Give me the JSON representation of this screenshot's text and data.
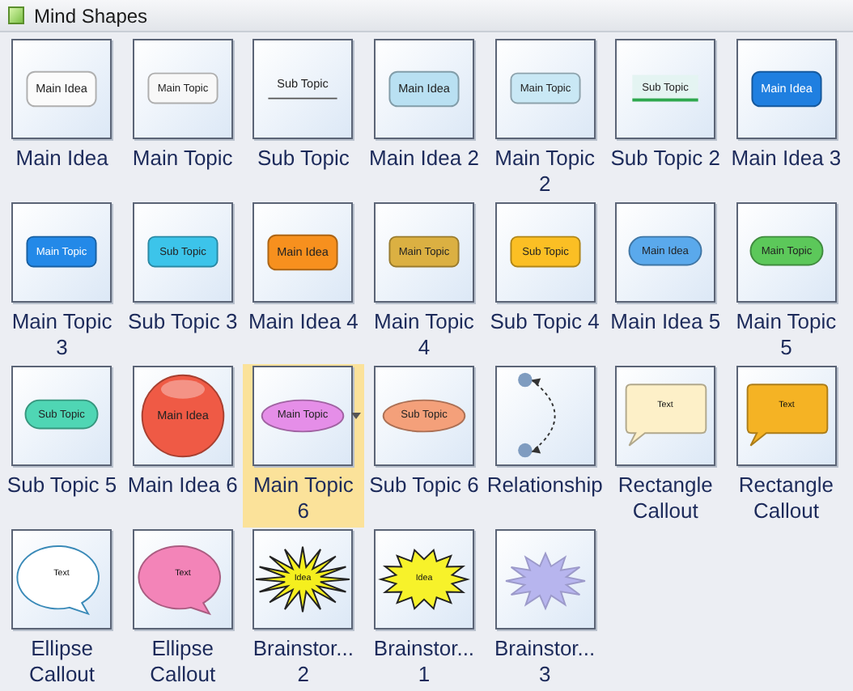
{
  "panel": {
    "title": "Mind Shapes"
  },
  "shapes": [
    {
      "label": "Main Idea",
      "kind": "box",
      "text": "Main Idea",
      "color": "#fbfbfb",
      "selected": false
    },
    {
      "label": "Main Topic",
      "kind": "box-small",
      "text": "Main Topic",
      "color": "#f8f8f8",
      "selected": false
    },
    {
      "label": "Sub Topic",
      "kind": "underline",
      "text": "Sub Topic",
      "color": "#555555",
      "selected": false
    },
    {
      "label": "Main Idea 2",
      "kind": "box",
      "text": "Main Idea",
      "color": "#b9e0f2",
      "selected": false
    },
    {
      "label": "Main Topic 2",
      "kind": "box-small",
      "text": "Main Topic",
      "color": "#c9e8f5",
      "selected": false
    },
    {
      "label": "Sub Topic 2",
      "kind": "tab",
      "text": "Sub Topic",
      "color": "#2fa84f",
      "selected": false
    },
    {
      "label": "Main Idea 3",
      "kind": "box",
      "text": "Main Idea",
      "color": "#1f7fe0",
      "selected": false
    },
    {
      "label": "Main Topic 3",
      "kind": "box-small",
      "text": "Main Topic",
      "color": "#2389e8",
      "selected": false
    },
    {
      "label": "Sub Topic 3",
      "kind": "box-small",
      "text": "Sub Topic",
      "color": "#3cc4ea",
      "selected": false
    },
    {
      "label": "Main Idea 4",
      "kind": "box",
      "text": "Main Idea",
      "color": "#f7901e",
      "selected": false
    },
    {
      "label": "Main Topic 4",
      "kind": "box-small",
      "text": "Main Topic",
      "color": "#dbb042",
      "selected": false
    },
    {
      "label": "Sub Topic 4",
      "kind": "box-small",
      "text": "Sub Topic",
      "color": "#fbbf24",
      "selected": false
    },
    {
      "label": "Main Idea 5",
      "kind": "pill",
      "text": "Main Idea",
      "color": "#5aa9ec",
      "selected": false
    },
    {
      "label": "Main Topic 5",
      "kind": "pill",
      "text": "Main Topic",
      "color": "#5cc85a",
      "selected": false
    },
    {
      "label": "Sub Topic 5",
      "kind": "pill",
      "text": "Sub Topic",
      "color": "#4fd6b4",
      "selected": false
    },
    {
      "label": "Main Idea 6",
      "kind": "circle",
      "text": "Main Idea",
      "color": "#ef5a45",
      "selected": false
    },
    {
      "label": "Main Topic 6",
      "kind": "ellipse",
      "text": "Main Topic",
      "color": "#e58ee8",
      "selected": true
    },
    {
      "label": "Sub Topic 6",
      "kind": "ellipse",
      "text": "Sub Topic",
      "color": "#f4a07a",
      "selected": false
    },
    {
      "label": "Relationship",
      "kind": "relationship",
      "color": "#7f9cc0",
      "selected": false
    },
    {
      "label": "Rectangle Callout",
      "kind": "rect-callout",
      "text": "Text",
      "color": "#fdf0c8",
      "selected": false
    },
    {
      "label": "Rectangle Callout",
      "kind": "rect-callout",
      "text": "Text",
      "color": "#f5b324",
      "selected": false
    },
    {
      "label": "Ellipse Callout",
      "kind": "ellipse-callout",
      "text": "Text",
      "color": "#ffffff",
      "selected": false
    },
    {
      "label": "Ellipse Callout",
      "kind": "ellipse-callout",
      "text": "Text",
      "color": "#f384b8",
      "selected": false
    },
    {
      "label": "Brainstor... 2",
      "kind": "burst",
      "text": "Idea",
      "color": "#f5ef1e",
      "selected": false
    },
    {
      "label": "Brainstor... 1",
      "kind": "burst-round",
      "text": "Idea",
      "color": "#f7f22a",
      "selected": false
    },
    {
      "label": "Brainstor... 3",
      "kind": "burst-soft",
      "color": "#b7b5ee",
      "selected": false
    }
  ]
}
